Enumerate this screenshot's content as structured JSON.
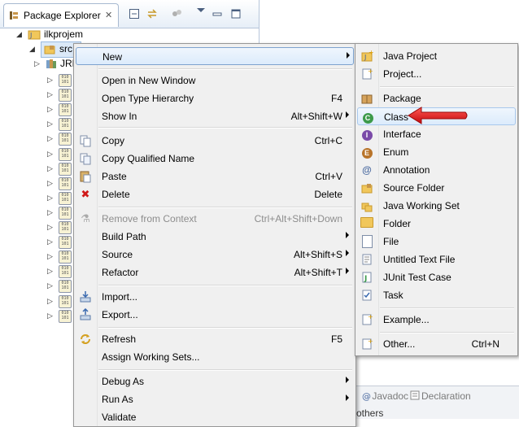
{
  "explorer": {
    "title": "Package Explorer",
    "tree": {
      "project": "ilkprojem",
      "src": "src",
      "jre": "JRE",
      "jar_rows": 17
    }
  },
  "bottom_tabs": {
    "javadoc": "Javadoc",
    "declaration": "Declaration",
    "others": "others"
  },
  "context_menu": {
    "items": [
      {
        "label": "New",
        "submenu": true
      },
      {
        "label": "Open in New Window"
      },
      {
        "label": "Open Type Hierarchy",
        "shortcut": "F4"
      },
      {
        "label": "Show In",
        "shortcut": "Alt+Shift+W",
        "submenu": true
      },
      {
        "label": "Copy",
        "shortcut": "Ctrl+C"
      },
      {
        "label": "Copy Qualified Name"
      },
      {
        "label": "Paste",
        "shortcut": "Ctrl+V"
      },
      {
        "label": "Delete",
        "shortcut": "Delete"
      },
      {
        "label": "Remove from Context",
        "shortcut": "Ctrl+Alt+Shift+Down",
        "disabled": true
      },
      {
        "label": "Build Path",
        "submenu": true
      },
      {
        "label": "Source",
        "shortcut": "Alt+Shift+S",
        "submenu": true
      },
      {
        "label": "Refactor",
        "shortcut": "Alt+Shift+T",
        "submenu": true
      },
      {
        "label": "Import..."
      },
      {
        "label": "Export..."
      },
      {
        "label": "Refresh",
        "shortcut": "F5"
      },
      {
        "label": "Assign Working Sets..."
      },
      {
        "label": "Debug As",
        "submenu": true
      },
      {
        "label": "Run As",
        "submenu": true
      },
      {
        "label": "Validate"
      }
    ]
  },
  "new_submenu": {
    "items": [
      {
        "label": "Java Project"
      },
      {
        "label": "Project..."
      },
      {
        "label": "Package"
      },
      {
        "label": "Class"
      },
      {
        "label": "Interface"
      },
      {
        "label": "Enum"
      },
      {
        "label": "Annotation"
      },
      {
        "label": "Source Folder"
      },
      {
        "label": "Java Working Set"
      },
      {
        "label": "Folder"
      },
      {
        "label": "File"
      },
      {
        "label": "Untitled Text File"
      },
      {
        "label": "JUnit Test Case"
      },
      {
        "label": "Task"
      },
      {
        "label": "Example..."
      },
      {
        "label": "Other...",
        "shortcut": "Ctrl+N"
      }
    ]
  },
  "colors": {
    "highlight": "#dcebfc",
    "arrow": "#e0141a",
    "menu_bg": "#f0f0f0"
  }
}
